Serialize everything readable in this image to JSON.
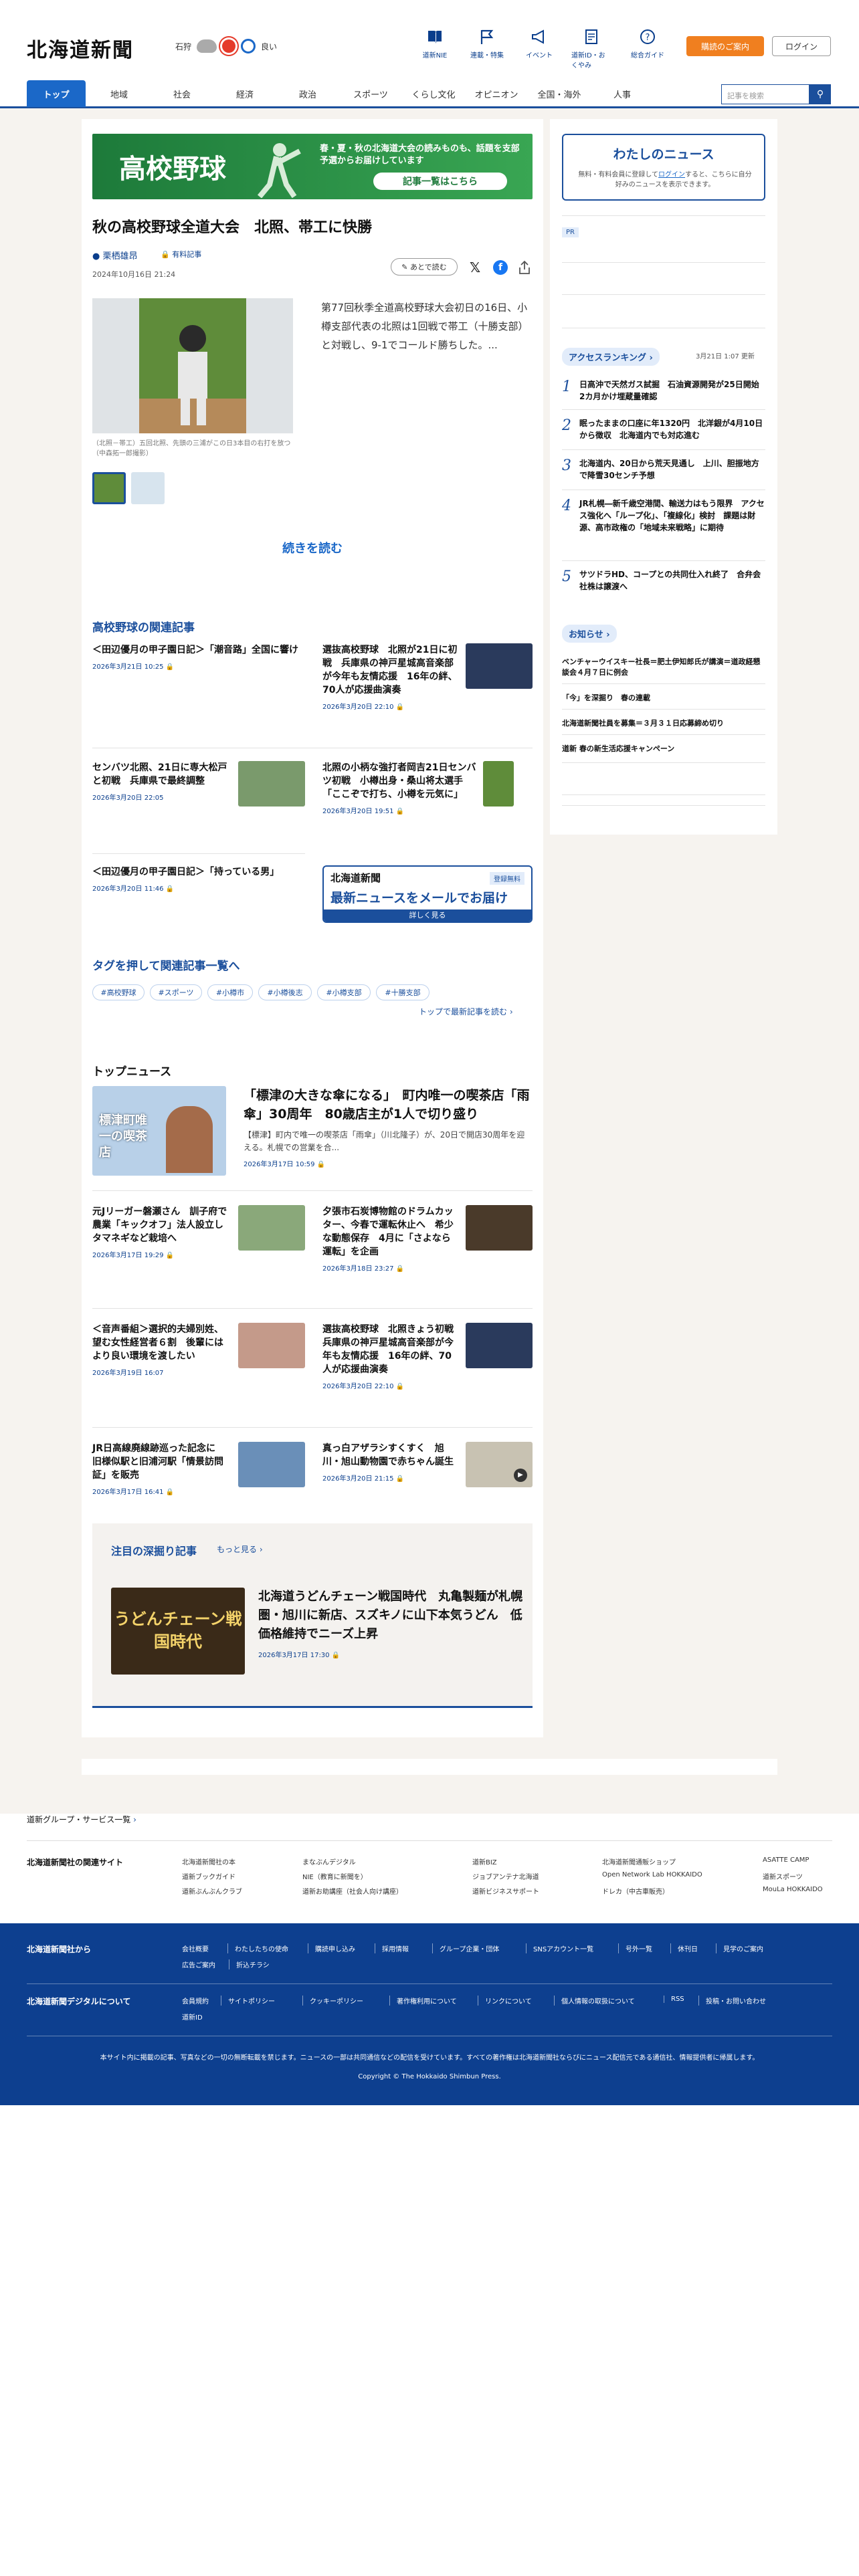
{
  "header": {
    "logo": "北海道新聞",
    "location": "石狩",
    "air_quality": "良い",
    "nav": [
      {
        "label": "道新NIE",
        "icon": "book-icon"
      },
      {
        "label": "連載・特集",
        "icon": "flag-icon"
      },
      {
        "label": "イベント",
        "icon": "megaphone-icon"
      },
      {
        "label": "道新ID・おくやみ",
        "icon": "document-icon"
      },
      {
        "label": "総合ガイド",
        "icon": "question-icon"
      }
    ],
    "subscribe": "購読のご案内",
    "login": "ログイン"
  },
  "global_nav": {
    "items": [
      "トップ",
      "地域",
      "社会",
      "経済",
      "政治",
      "スポーツ",
      "くらし文化",
      "オピニオン",
      "全国・海外",
      "人事"
    ],
    "search_placeholder": "記事を検索"
  },
  "banner": {
    "title": "高校野球",
    "text": "春・夏・秋の北海道大会の読みものも、話題を支部予選からお届けしています",
    "button": "記事一覧はこちら"
  },
  "article": {
    "headline": "秋の高校野球全道大会　北照、帯工に快勝",
    "author": "栗栖雄昂",
    "paid_label": "有料記事",
    "datetime": "2024年10月16日 21:24",
    "later_button": "あとで読む",
    "caption": "（北照－帯工）五回北照、先頭の三浦がこの日3本目の右打を放つ（中森拓一郎撮影）",
    "lead": "第77回秋季全道高校野球大会初日の16日、小樽支部代表の北照は1回戦で帯工（十勝支部）と対戦し、9-1でコールド勝ちした。...",
    "read_more": "続きを読む"
  },
  "related": {
    "title": "高校野球の関連記事",
    "items": [
      {
        "title": "＜田辺優月の甲子園日記＞「潮音路」全国に響け",
        "date": "2026年3月21日 10:25"
      },
      {
        "title": "選抜高校野球　北照が21日に初戦　兵庫県の神戸星城高音楽部が今年も友情応援　16年の絆、70人が応援曲演奏",
        "date": "2026年3月20日 22:10"
      },
      {
        "title": "センバツ北照、21日に専大松戸と初戦　兵庫県で最終調整",
        "date": "2026年3月20日 22:05"
      },
      {
        "title": "北照の小柄な強打者岡吉21日センバツ初戦　小樽出身・桑山将太選手「ここぞで打ち、小樽を元気に」",
        "date": "2026年3月20日 19:51"
      },
      {
        "title": "＜田辺優月の甲子園日記＞「持っている男」",
        "date": "2026年3月20日 11:46"
      }
    ]
  },
  "mail_ad": {
    "logo": "北海道新聞",
    "free": "登録無料",
    "text": "最新ニュースをメールでお届け",
    "button": "詳しく見る"
  },
  "tags": {
    "title": "タグを押して関連記事一覧へ",
    "items": [
      "#高校野球",
      "#スポーツ",
      "#小樽市",
      "#小樽後志",
      "#小樽支部",
      "#十勝支部"
    ],
    "link": "トップで最新記事を読む"
  },
  "top_news": {
    "title": "トップニュース",
    "main": {
      "title": "「標津の大きな傘になる」　町内唯一の喫茶店「雨傘」30周年　80歳店主が1人で切り盛り",
      "summary": "【標津】町内で唯一の喫茶店「雨傘」（川北隆子）が、20日で開店30周年を迎える。札幌での営業を合...",
      "date": "2026年3月17日 10:59",
      "image_text": "標津町唯一の喫茶店"
    },
    "items": [
      {
        "title": "元Jリーガー磐瀬さん　訓子府で農業「キックオフ」法人設立しタマネギなど栽培へ",
        "date": "2026年3月17日 19:29"
      },
      {
        "title": "夕張市石炭博物館のドラムカッター、今春で運転休止へ　希少な動態保存　4月に「さよなら運転」を企画",
        "date": "2026年3月18日 23:27"
      },
      {
        "title": "＜音声番組＞選択的夫婦別姓、望む女性経営者６割　後輩にはより良い環境を渡したい",
        "date": "2026年3月19日 16:07"
      },
      {
        "title": "選抜高校野球　北照きょう初戦　兵庫県の神戸星城高音楽部が今年も友情応援　16年の絆、70人が応援曲演奏",
        "date": "2026年3月20日 22:10"
      },
      {
        "title": "JR日高線廃線跡巡った記念に　旧様似駅と旧浦河駅「情景訪問証」を販売",
        "date": "2026年3月17日 16:41"
      },
      {
        "title": "真っ白アザラシすくすく　旭川・旭山動物園で赤ちゃん誕生",
        "date": "2026年3月20日 21:15"
      }
    ]
  },
  "deep_dive": {
    "title": "注目の深掘り記事",
    "more": "もっと見る",
    "article_title": "北海道うどんチェーン戦国時代　丸亀製麺が札幌圏・旭川に新店、スズキノに山下本気うどん　低価格維持でニーズ上昇",
    "date": "2026年3月17日 17:30",
    "image_text": "うどんチェーン戦国時代"
  },
  "sidebar": {
    "mynews_title": "わたしのニュース",
    "mynews_text_pre": "無料・有料会員に登録して",
    "mynews_link": "ログイン",
    "mynews_text_post": "すると、こちらに自分好みのニュースを表示できます。",
    "pr": "PR",
    "ranking_title": "アクセスランキング",
    "ranking_updated": "3月21日 1:07 更新",
    "ranking": [
      "日高沖で天然ガス試掘　石油資源開発が25日開始　2カ月かけ埋蔵量確認",
      "眠ったままの口座に年1320円　北洋銀が4月10日から徴収　北海道内でも対応進む",
      "北海道内、20日から荒天見通し　上川、胆振地方で降雪30センチ予想",
      "JR札幌―新千歳空港間、輸送力はもう限界　アクセス強化へ「ループ化」、「複線化」検討　課題は財源、高市政権の「地域未来戦略」に期待",
      "サツドラHD、コープとの共同仕入れ終了　合弁会社株は譲渡へ"
    ],
    "notice_title": "お知らせ",
    "notices": [
      "ベンチャーウイスキー社長＝肥土伊知郎氏が講演＝道政経懇談会４月７日に例会",
      "「今」を深掘り　春の連載",
      "北海道新聞社員を募集＝３月３１日応募締め切り",
      "道新 春の新生活応援キャンペーン"
    ]
  },
  "footer": {
    "group_link": "道新グループ・サービス一覧",
    "related_title": "北海道新聞社の関連サイト",
    "related_sites": [
      [
        "北海道新聞社の本",
        "道新ブックガイド",
        "道新ぶんぶんクラブ"
      ],
      [
        "まなぶんデジタル",
        "NIE（教育に新聞を）",
        "道新お助講座（社会人向け講座）"
      ],
      [
        "道新BIZ",
        "ジョブアンテナ北海道",
        "道新ビジネスサポート"
      ],
      [
        "北海道新聞通販ショップ",
        "Open Network Lab HOKKAIDO",
        "ドレカ（中古車販売）"
      ],
      [
        "ASATTE CAMP",
        "道新スポーツ",
        "MouLa HOKKAIDO"
      ]
    ],
    "company_title": "北海道新聞社から",
    "company_links": [
      "会社概要",
      "わたしたちの使命",
      "購読申し込み",
      "採用情報",
      "グループ企業・団体",
      "SNSアカウント一覧",
      "号外一覧",
      "休刊日",
      "見学のご案内",
      "広告ご案内",
      "折込チラシ"
    ],
    "digital_title": "北海道新聞デジタルについて",
    "digital_links": [
      "会員規約",
      "サイトポリシー",
      "クッキーポリシー",
      "著作権利用について",
      "リンクについて",
      "個人情報の取扱について",
      "RSS",
      "投稿・お問い合わせ",
      "道新ID"
    ],
    "note": "本サイト内に掲載の記事、写真などの一切の無断転載を禁じます。ニュースの一部は共同通信などの配信を受けています。すべての著作権は北海道新聞社ならびにニュース配信元である通信社、情報提供者に帰属します。",
    "copyright": "Copyright © The Hokkaido Shimbun Press."
  }
}
